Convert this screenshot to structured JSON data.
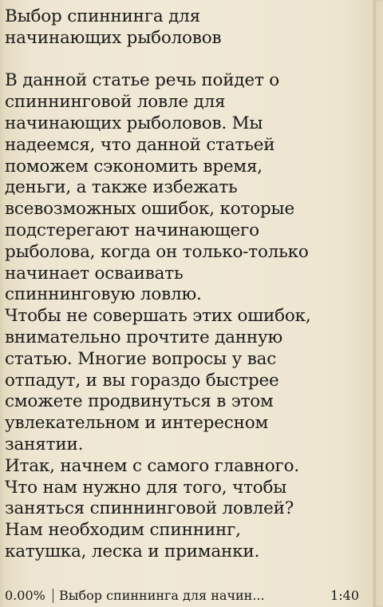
{
  "article": {
    "title_lines": [
      "Выбор спиннинга для",
      "начинающих рыболовов"
    ],
    "body_lines": [
      "В данной статье речь пойдет о",
      "спиннинговой ловле для",
      "начинающих рыболовов. Мы",
      "надеемся, что данной статьей",
      "поможем сэкономить время,",
      "деньги, а также избежать",
      "всевозможных ошибок, которые",
      "подстерегают начинающего",
      "рыболова, когда он только-только",
      "начинает осваивать",
      "спиннинговую ловлю.",
      "Чтобы не совершать этих ошибок,",
      "внимательно прочтите данную",
      "статью. Многие вопросы у вас",
      "отпадут, и вы гораздо быстрее",
      "сможете продвинуться в этом",
      "увлекательном и интересном",
      "занятии.",
      "Итак, начнем с самого главного.",
      "Что нам нужно для того, чтобы",
      "заняться спиннинговой ловлей?",
      "Нам необходим спиннинг,",
      "катушка, леска и приманки."
    ]
  },
  "status_bar": {
    "progress": "0.00%",
    "document_title": "Выбор спиннинга для начин...",
    "time": "1:40"
  }
}
